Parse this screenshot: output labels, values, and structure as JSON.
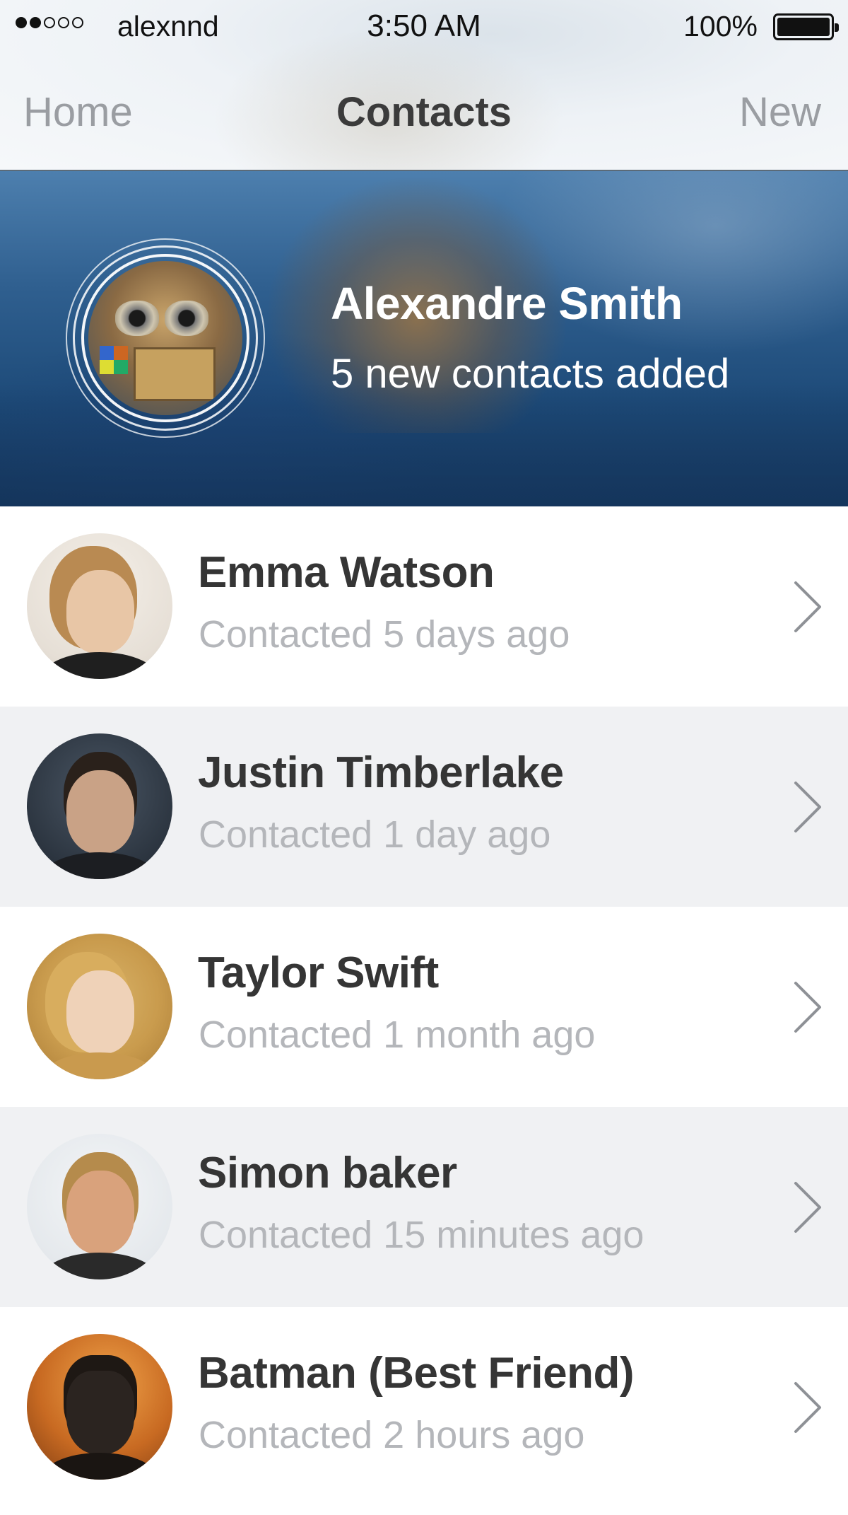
{
  "status_bar": {
    "signal_bars_filled": 2,
    "signal_bars_total": 5,
    "carrier": "alexnnd",
    "time": "3:50 AM",
    "battery": "100%"
  },
  "nav": {
    "left": "Home",
    "title": "Contacts",
    "right": "New"
  },
  "profile": {
    "name": "Alexandre Smith",
    "subtitle": "5 new contacts added"
  },
  "contacts": [
    {
      "name": "Emma Watson",
      "status": "Contacted 5 days ago"
    },
    {
      "name": "Justin Timberlake",
      "status": "Contacted 1 day ago"
    },
    {
      "name": "Taylor Swift",
      "status": "Contacted 1 month ago"
    },
    {
      "name": "Simon baker",
      "status": "Contacted 15 minutes ago"
    },
    {
      "name": "Batman (Best Friend)",
      "status": "Contacted 2 hours ago"
    }
  ],
  "icons": {
    "chevron": "chevron-right-icon",
    "battery": "battery-icon",
    "signal": "signal-strength-icon"
  },
  "colors": {
    "nav_text": "#9a9da2",
    "title_text": "#3b3b3b",
    "banner_blue": "#2f5f8f",
    "row_alt": "#f0f1f3",
    "secondary_text": "#b4b6ba"
  }
}
